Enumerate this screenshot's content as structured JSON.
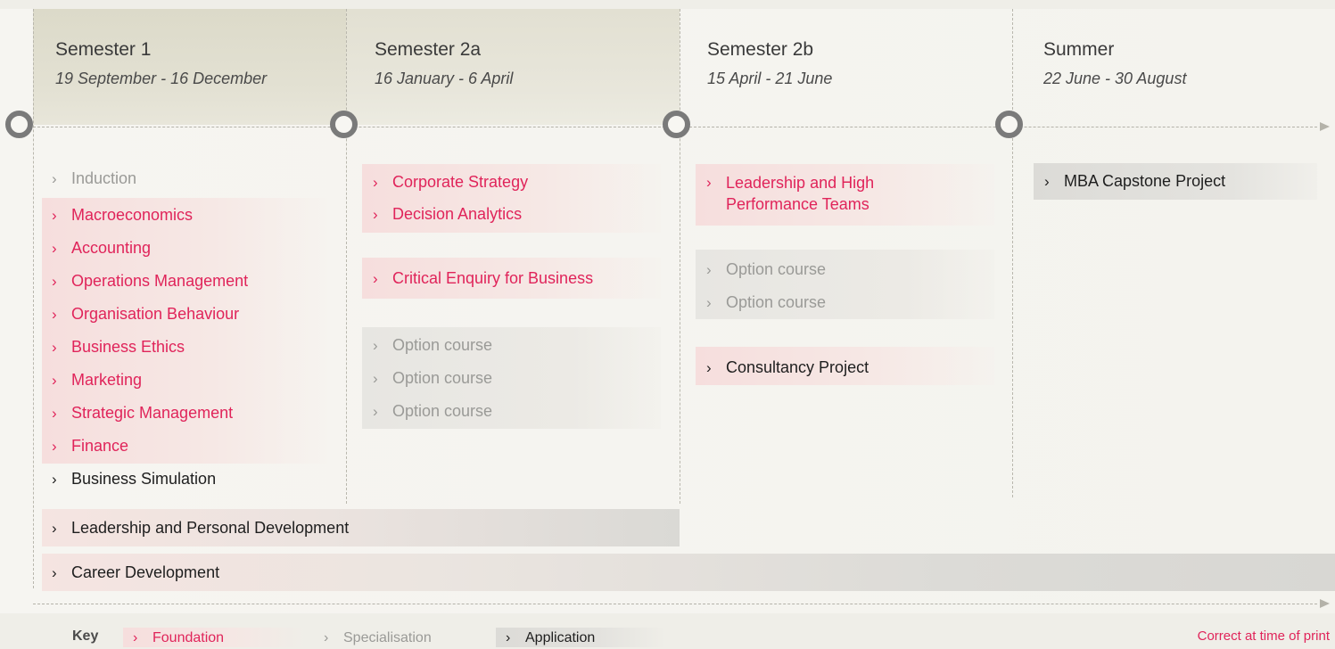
{
  "semesters": [
    {
      "title": "Semester 1",
      "dates": "19 September - 16 December"
    },
    {
      "title": "Semester 2a",
      "dates": "16 January - 6 April"
    },
    {
      "title": "Semester 2b",
      "dates": "15 April - 21 June"
    },
    {
      "title": "Summer",
      "dates": "22 June - 30 August"
    }
  ],
  "semester1": {
    "induction": "Induction",
    "foundation": [
      "Macroeconomics",
      "Accounting",
      "Operations Management",
      "Organisation Behaviour",
      "Business Ethics",
      "Marketing",
      "Strategic Management",
      "Finance"
    ],
    "application": "Business Simulation"
  },
  "semester2a": {
    "foundation": [
      "Corporate Strategy",
      "Decision Analytics"
    ],
    "foundation2": "Critical Enquiry for Business",
    "options": [
      "Option course",
      "Option course",
      "Option course"
    ]
  },
  "semester2b": {
    "foundation": "Leadership and High Performance Teams",
    "options": [
      "Option course",
      "Option course"
    ],
    "application": "Consultancy Project"
  },
  "summer": {
    "application": "MBA Capstone Project"
  },
  "spanning": {
    "leadership": "Leadership and Personal Development",
    "career": "Career Development"
  },
  "key": {
    "label": "Key",
    "foundation": "Foundation",
    "specialisation": "Specialisation",
    "application": "Application"
  },
  "chevron": "›",
  "footer_note": "Correct at time of print",
  "colors": {
    "foundation": "#e0245a",
    "specialisation": "#9a9a97",
    "application": "#1e1e1e",
    "node": "#7a7a7a"
  }
}
